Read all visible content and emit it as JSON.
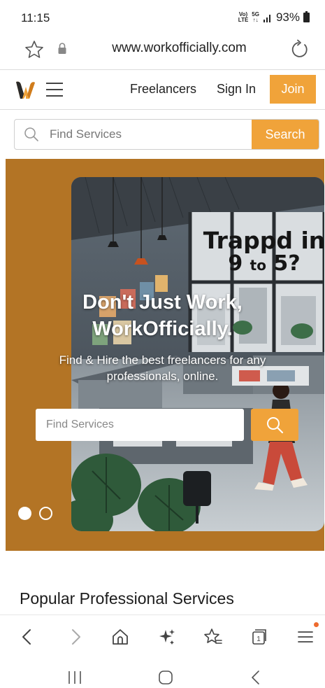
{
  "status_bar": {
    "time": "11:15",
    "network_top": "Vo)",
    "network_bottom": "LTE",
    "gen_top": "5G",
    "gen_bottom": "↑↓",
    "battery": "93%"
  },
  "browser": {
    "url": "www.workofficially.com"
  },
  "header": {
    "nav": {
      "freelancers": "Freelancers",
      "signin": "Sign In",
      "join": "Join"
    }
  },
  "search": {
    "placeholder": "Find Services",
    "button": "Search"
  },
  "hero": {
    "sign_line1": "Trappd in",
    "sign_line2_a": "9",
    "sign_line2_b": "to",
    "sign_line2_c": "5?",
    "headline_line1": "Don't Just Work,",
    "headline_line2": "WorkOfficially.",
    "subtitle": "Find & Hire the best freelancers for any professionals, online.",
    "search_placeholder": "Find Services",
    "slides": 2,
    "active_slide": 1
  },
  "section": {
    "title": "Popular Professional Services"
  },
  "colors": {
    "accent": "#f0a33a",
    "hero_bg": "#b37425",
    "menu_badge": "#ee6b2e"
  },
  "icons": {
    "toolbar": [
      "back-icon",
      "forward-icon",
      "home-icon",
      "sparkle-icon",
      "bookmarks-icon",
      "tabs-icon",
      "menu-icon"
    ],
    "system": [
      "recents-icon",
      "home-circle-icon",
      "system-back-icon"
    ],
    "tabs_count": "1"
  }
}
